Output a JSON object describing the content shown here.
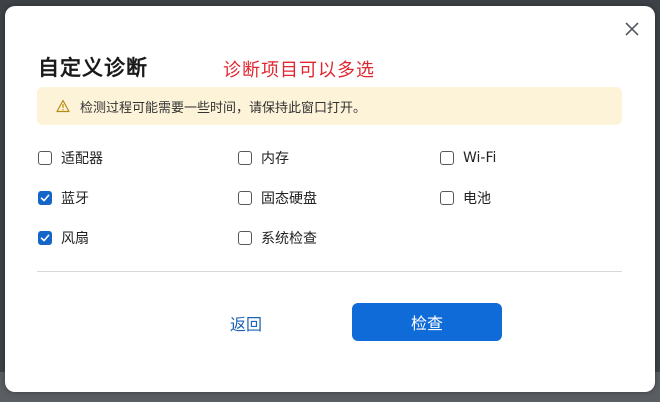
{
  "dialog": {
    "title": "自定义诊断",
    "annotation": "诊断项目可以多选",
    "notice": "检测过程可能需要一些时间，请保持此窗口打开。",
    "items": [
      {
        "label": "适配器",
        "checked": false
      },
      {
        "label": "内存",
        "checked": false
      },
      {
        "label": "Wi-Fi",
        "checked": false
      },
      {
        "label": "蓝牙",
        "checked": true
      },
      {
        "label": "固态硬盘",
        "checked": false
      },
      {
        "label": "电池",
        "checked": false
      },
      {
        "label": "风扇",
        "checked": true
      },
      {
        "label": "系统检查",
        "checked": false
      }
    ],
    "back_label": "返回",
    "check_label": "检查"
  },
  "icons": {
    "close": "close-icon",
    "warning": "warning-icon",
    "checkmark": "checkmark-icon"
  },
  "colors": {
    "accent": "#0f6bd8",
    "annotation": "#e0262f",
    "notice_bg": "#fcf3d9"
  }
}
